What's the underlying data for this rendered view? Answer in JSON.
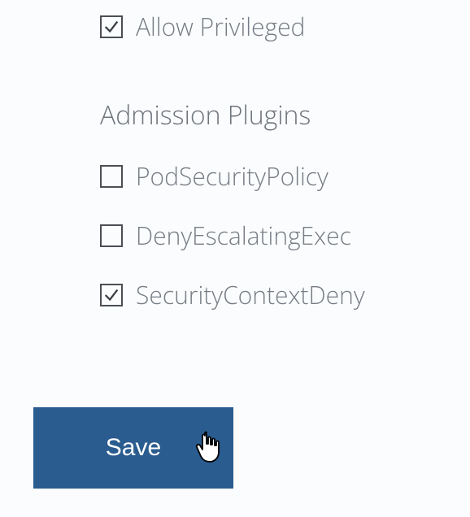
{
  "options": {
    "allow_privileged": {
      "label": "Allow Privileged",
      "checked": true
    }
  },
  "admission_plugins": {
    "heading": "Admission Plugins",
    "items": [
      {
        "label": "PodSecurityPolicy",
        "checked": false
      },
      {
        "label": "DenyEscalatingExec",
        "checked": false
      },
      {
        "label": "SecurityContextDeny",
        "checked": true
      }
    ]
  },
  "actions": {
    "save_label": "Save"
  }
}
